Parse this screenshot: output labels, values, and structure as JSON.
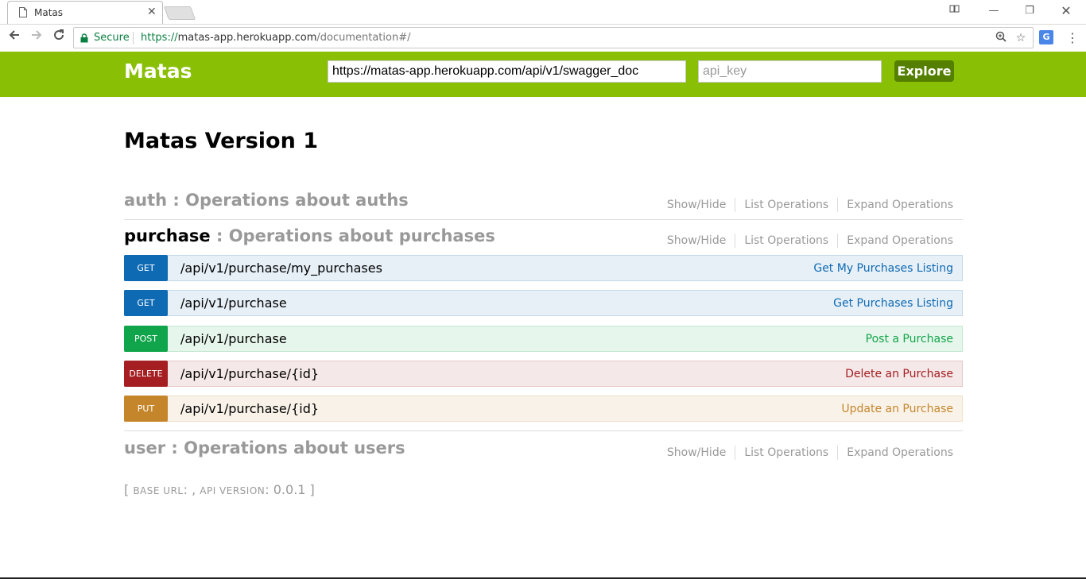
{
  "browser": {
    "tab_title": "Matas",
    "secure_label": "Secure",
    "url_scheme": "https://",
    "url_host": "matas-app.herokuapp.com",
    "url_path": "/documentation#/"
  },
  "header": {
    "logo": "Matas",
    "spec_url_value": "https://matas-app.herokuapp.com/api/v1/swagger_doc",
    "api_key_placeholder": "api_key",
    "explore_label": "Explore",
    "color": "#89bf04"
  },
  "main": {
    "title": "Matas Version 1",
    "resources": [
      {
        "name": "auth",
        "sep": " : ",
        "description": "Operations about auths",
        "options": [
          "Show/Hide",
          "List Operations",
          "Expand Operations"
        ]
      },
      {
        "name": "purchase",
        "sep": " : ",
        "description": "Operations about purchases",
        "options": [
          "Show/Hide",
          "List Operations",
          "Expand Operations"
        ],
        "operations": [
          {
            "method": "GET",
            "path": "/api/v1/purchase/my_purchases",
            "summary": "Get My Purchases Listing"
          },
          {
            "method": "GET",
            "path": "/api/v1/purchase",
            "summary": "Get Purchases Listing"
          },
          {
            "method": "POST",
            "path": "/api/v1/purchase",
            "summary": "Post a Purchase"
          },
          {
            "method": "DELETE",
            "path": "/api/v1/purchase/{id}",
            "summary": "Delete an Purchase"
          },
          {
            "method": "PUT",
            "path": "/api/v1/purchase/{id}",
            "summary": "Update an Purchase"
          }
        ]
      },
      {
        "name": "user",
        "sep": " : ",
        "description": "Operations about users",
        "options": [
          "Show/Hide",
          "List Operations",
          "Expand Operations"
        ]
      }
    ],
    "footer": {
      "open": "[ ",
      "base_url_label": "base url",
      "base_url_value": ": , ",
      "api_version_label": "api version",
      "api_version_value": ": 0.0.1",
      "close": " ]"
    }
  }
}
